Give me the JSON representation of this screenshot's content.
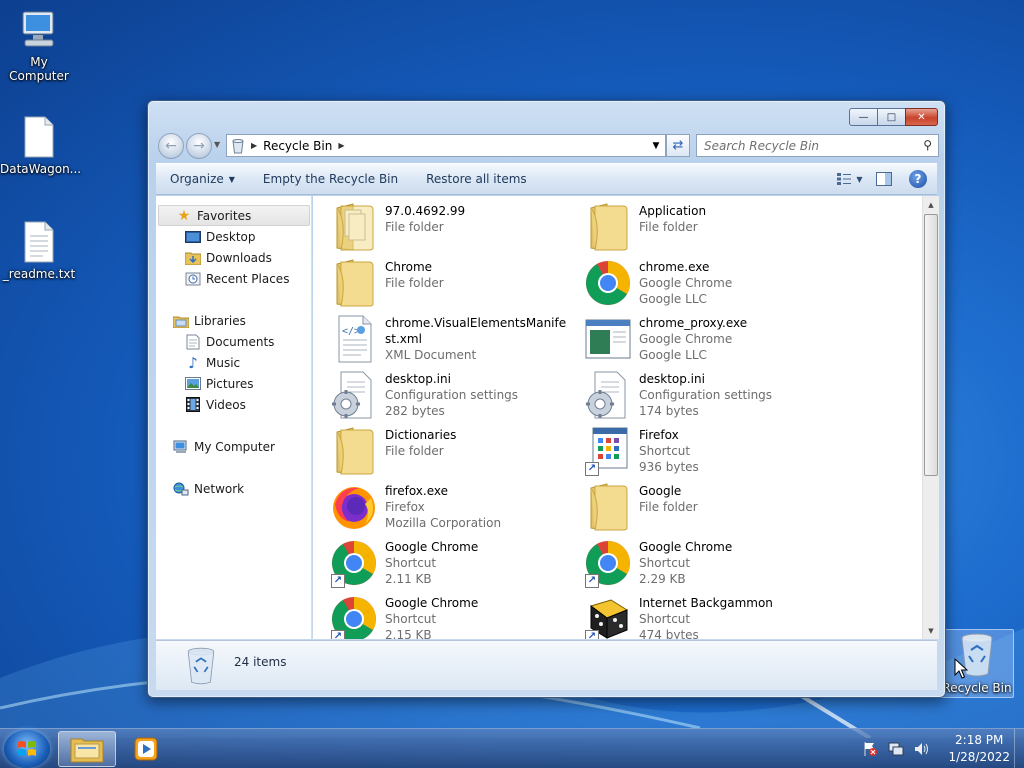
{
  "desktop": {
    "icons": [
      {
        "label": "My Computer"
      },
      {
        "label": "DataWagon..."
      },
      {
        "label": "_readme.txt"
      },
      {
        "label": "Recycle Bin"
      }
    ]
  },
  "window": {
    "address": {
      "location": "Recycle Bin"
    },
    "search": {
      "placeholder": "Search Recycle Bin"
    },
    "toolbar": {
      "organize": "Organize",
      "empty": "Empty the Recycle Bin",
      "restore": "Restore all items"
    },
    "nav": {
      "favorites": "Favorites",
      "desktop": "Desktop",
      "downloads": "Downloads",
      "recent": "Recent Places",
      "libraries": "Libraries",
      "documents": "Documents",
      "music": "Music",
      "pictures": "Pictures",
      "videos": "Videos",
      "computer": "My Computer",
      "network": "Network"
    },
    "files": [
      {
        "name": "97.0.4692.99",
        "line2": "File folder",
        "line3": "",
        "icon": "folder-docs"
      },
      {
        "name": "Application",
        "line2": "File folder",
        "line3": "",
        "icon": "folder"
      },
      {
        "name": "Chrome",
        "line2": "File folder",
        "line3": "",
        "icon": "folder"
      },
      {
        "name": "chrome.exe",
        "line2": "Google Chrome",
        "line3": "Google LLC",
        "icon": "chrome"
      },
      {
        "name": "chrome.VisualElementsManifest.xml",
        "line2": "XML Document",
        "line3": "",
        "icon": "xml-doc"
      },
      {
        "name": "chrome_proxy.exe",
        "line2": "Google Chrome",
        "line3": "Google LLC",
        "icon": "app-window"
      },
      {
        "name": "desktop.ini",
        "line2": "Configuration settings",
        "line3": "282 bytes",
        "icon": "config"
      },
      {
        "name": "desktop.ini",
        "line2": "Configuration settings",
        "line3": "174 bytes",
        "icon": "config"
      },
      {
        "name": "Dictionaries",
        "line2": "File folder",
        "line3": "",
        "icon": "folder"
      },
      {
        "name": "Firefox",
        "line2": "Shortcut",
        "line3": "936 bytes",
        "icon": "shortcut-doc"
      },
      {
        "name": "firefox.exe",
        "line2": "Firefox",
        "line3": "Mozilla Corporation",
        "icon": "firefox"
      },
      {
        "name": "Google",
        "line2": "File folder",
        "line3": "",
        "icon": "folder"
      },
      {
        "name": "Google Chrome",
        "line2": "Shortcut",
        "line3": "2.11 KB",
        "icon": "chrome-shortcut"
      },
      {
        "name": "Google Chrome",
        "line2": "Shortcut",
        "line3": "2.29 KB",
        "icon": "chrome-shortcut"
      },
      {
        "name": "Google Chrome",
        "line2": "Shortcut",
        "line3": "2.15 KB",
        "icon": "chrome-shortcut"
      },
      {
        "name": "Internet Backgammon",
        "line2": "Shortcut",
        "line3": "474 bytes",
        "icon": "backgammon-shortcut"
      }
    ],
    "status": {
      "count": "24 items"
    }
  },
  "taskbar": {
    "clock_time": "2:18 PM",
    "clock_date": "1/28/2022"
  }
}
